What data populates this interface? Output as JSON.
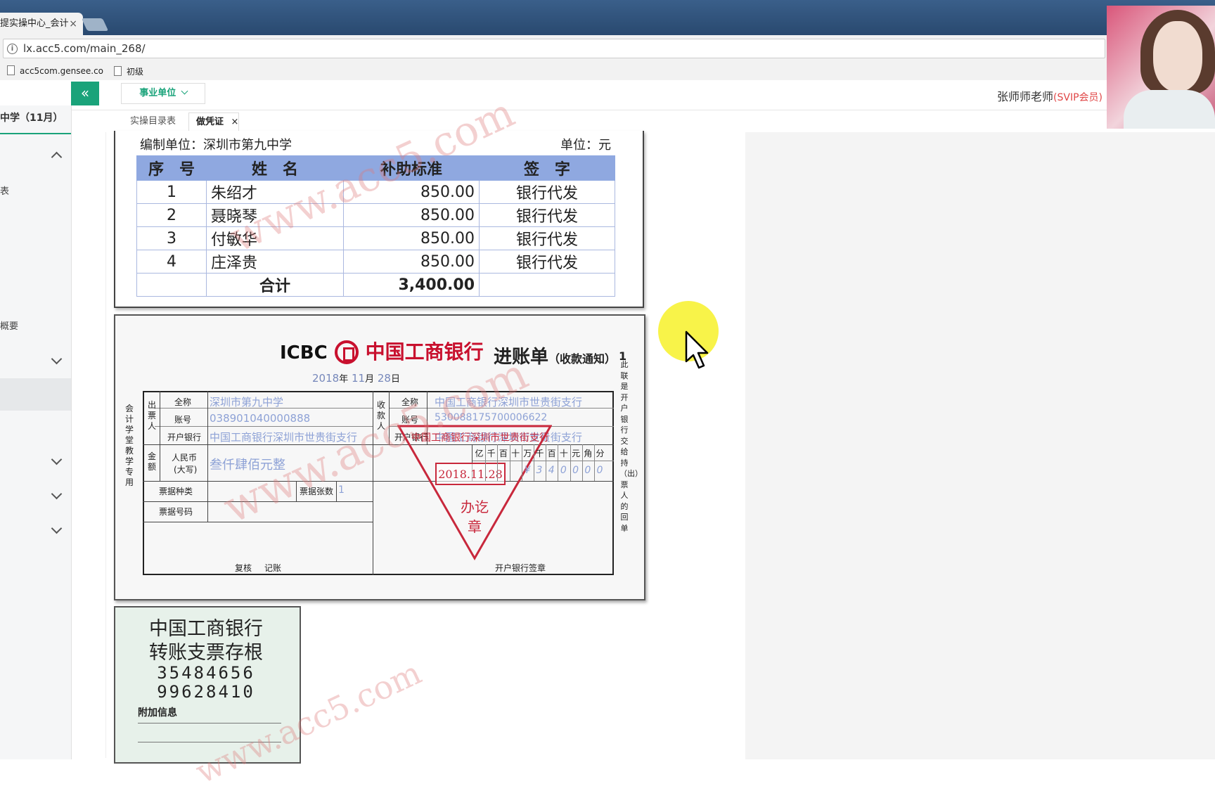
{
  "browser": {
    "tab_title": "提实操中心_会计",
    "tab_close": "×",
    "url": "lx.acc5.com/main_268/",
    "bookmarks": [
      "acc5com.gensee.co",
      "初级"
    ]
  },
  "header": {
    "collapse_icon": "«",
    "unit_select": "事业单位",
    "user_name": "张师师老师",
    "user_badge": "(SVIP会员)"
  },
  "sidebar": {
    "title": "中学（11月）",
    "items": [
      "表",
      "概要"
    ]
  },
  "page_tabs": [
    {
      "label": "实操目录表"
    },
    {
      "label": "做凭证",
      "close": "×"
    }
  ],
  "allowance_sheet": {
    "prepared_by": "编制单位：深圳市第九中学",
    "unit": "单位：元",
    "headers": [
      "序　号",
      "姓　名",
      "补助标准",
      "签　字"
    ],
    "rows": [
      {
        "no": "1",
        "name": "朱绍才",
        "amount": "850.00",
        "sign": "银行代发"
      },
      {
        "no": "2",
        "name": "聂晓琴",
        "amount": "850.00",
        "sign": "银行代发"
      },
      {
        "no": "3",
        "name": "付敏华",
        "amount": "850.00",
        "sign": "银行代发"
      },
      {
        "no": "4",
        "name": "庄泽贵",
        "amount": "850.00",
        "sign": "银行代发"
      }
    ],
    "total_label": "合计",
    "total_amount": "3,400.00"
  },
  "bank_slip": {
    "bank_en": "ICBC",
    "bank_cn": "中国工商银行",
    "title": "进账单",
    "subtitle": "（收款通知）",
    "copy_no": "1",
    "date_year": "2018",
    "date_month": "11",
    "date_day": "28",
    "date_units": [
      "年",
      "月",
      "日"
    ],
    "left_vertical": "会计学堂教学专用",
    "right_vertical": "此联是开户银行交给持（出）票人的回单",
    "payer_label": "出票人",
    "payee_label": "收款人",
    "field_labels": {
      "full_name": "全称",
      "account": "账号",
      "bank": "开户银行"
    },
    "payer_name": "深圳市第九中学",
    "payer_account": "038901040000888",
    "payer_bank": "中国工商银行深圳市世贵街支行",
    "payee_name": "中国工商银行深圳市世贵街支行",
    "payee_account": "530088175700006622",
    "payee_bank": "中国工商银行深圳市世贵街支行",
    "amount_label": "金额",
    "rmb_label": "人民币",
    "rmb_sub": "(大写)",
    "amount_words": "叁仟肆佰元整",
    "digit_headers": [
      "亿",
      "千",
      "百",
      "十",
      "万",
      "千",
      "百",
      "十",
      "元",
      "角",
      "分"
    ],
    "digits": [
      "",
      "",
      "",
      "",
      "",
      "¥",
      "3",
      "4",
      "0",
      "0",
      "0",
      "0"
    ],
    "bill_type_label": "票据种类",
    "bill_count_label": "票据张数",
    "bill_count": "1",
    "bill_no_label": "票据号码",
    "review_label": "复核",
    "book_label": "记账",
    "bank_sign_label": "开户银行签章",
    "stamp_bank": "中国工商银行深圳市世贵街支行",
    "stamp_date": "2018.11.28",
    "stamp_label": "办讫章"
  },
  "cheque_stub": {
    "bank": "中国工商银行",
    "title": "转账支票存根",
    "number1": "35484656",
    "number2": "99628410",
    "extra_label": "附加信息"
  },
  "watermark": "www.acc5.com",
  "colors": {
    "accent": "#1aa37a",
    "header_blue": "#8fa8e0",
    "stamp_red": "#c8283c",
    "vip_red": "#e04646"
  }
}
